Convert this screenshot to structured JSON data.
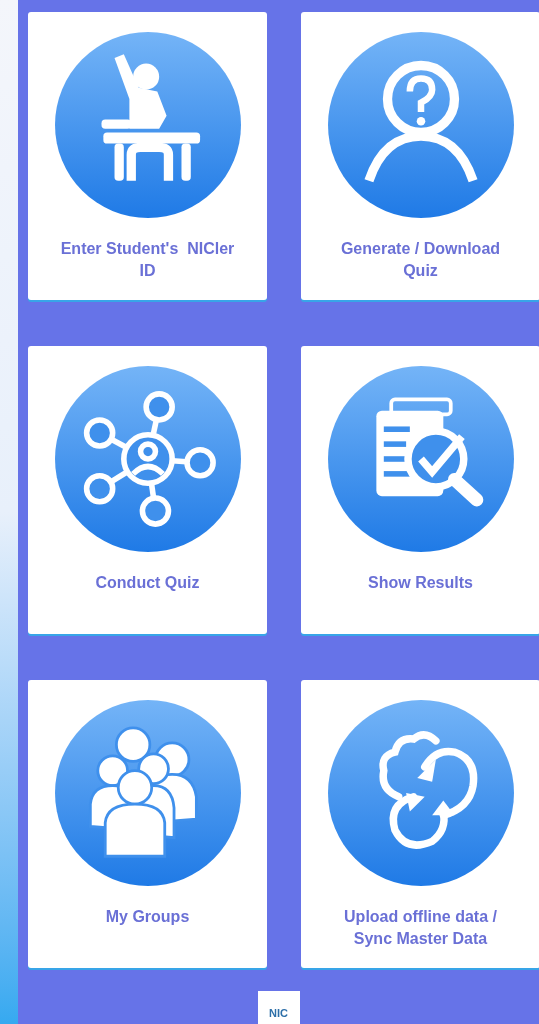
{
  "menu_cards": [
    {
      "label": "Enter Student's  NICler ID"
    },
    {
      "label": "Generate / Download Quiz"
    },
    {
      "label": "Conduct Quiz"
    },
    {
      "label": "Show Results"
    },
    {
      "label": "My Groups"
    },
    {
      "label": "Upload offline data / Sync Master Data"
    }
  ],
  "footer_logo": "NIC"
}
